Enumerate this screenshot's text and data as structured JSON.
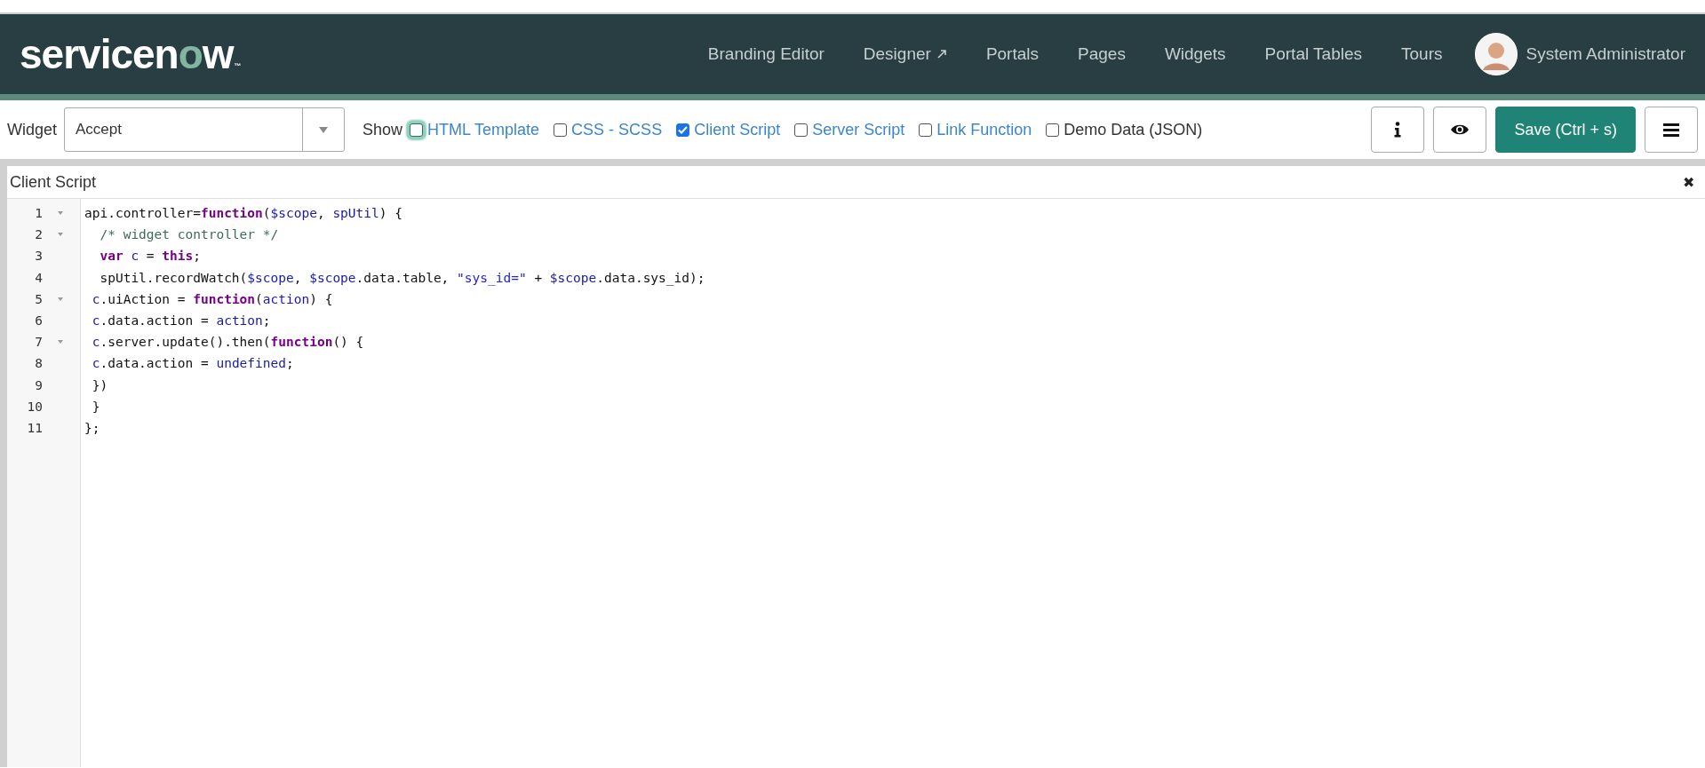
{
  "header": {
    "logo": "servicenow",
    "logo_mark": "™",
    "nav": [
      {
        "label": "Branding Editor",
        "external": false
      },
      {
        "label": "Designer",
        "external": true
      },
      {
        "label": "Portals",
        "external": false
      },
      {
        "label": "Pages",
        "external": false
      },
      {
        "label": "Widgets",
        "external": false
      },
      {
        "label": "Portal Tables",
        "external": false
      },
      {
        "label": "Tours",
        "external": false
      }
    ],
    "user": {
      "name": "System Administrator"
    }
  },
  "toolbar": {
    "widget_label": "Widget",
    "widget_value": "Accept",
    "show_label": "Show",
    "toggles": [
      {
        "label": "HTML Template",
        "checked": false,
        "focused": true,
        "kind": "link"
      },
      {
        "label": "CSS - SCSS",
        "checked": false,
        "focused": false,
        "kind": "link"
      },
      {
        "label": "Client Script",
        "checked": true,
        "focused": false,
        "kind": "link"
      },
      {
        "label": "Server Script",
        "checked": false,
        "focused": false,
        "kind": "link"
      },
      {
        "label": "Link Function",
        "checked": false,
        "focused": false,
        "kind": "link"
      },
      {
        "label": "Demo Data (JSON)",
        "checked": false,
        "focused": false,
        "kind": "plain"
      }
    ],
    "save_label": "Save (Ctrl + s)"
  },
  "panel": {
    "title": "Client Script",
    "close": "✖",
    "lines": [
      {
        "number": "1",
        "fold": true,
        "tokens": [
          {
            "kind": "plain",
            "text": "api.controller="
          },
          {
            "kind": "keyword",
            "text": "function"
          },
          {
            "kind": "plain",
            "text": "("
          },
          {
            "kind": "variable",
            "text": "$scope"
          },
          {
            "kind": "plain",
            "text": ", "
          },
          {
            "kind": "variable",
            "text": "spUtil"
          },
          {
            "kind": "plain",
            "text": ") {"
          }
        ]
      },
      {
        "number": "2",
        "fold": true,
        "tokens": [
          {
            "kind": "comment",
            "text": "  /* widget controller */"
          }
        ]
      },
      {
        "number": "3",
        "fold": false,
        "tokens": [
          {
            "kind": "keyword",
            "text": "  var"
          },
          {
            "kind": "variable",
            "text": " c"
          },
          {
            "kind": "plain",
            "text": " = "
          },
          {
            "kind": "keyword",
            "text": "this"
          },
          {
            "kind": "plain",
            "text": ";"
          }
        ]
      },
      {
        "number": "4",
        "fold": false,
        "tokens": [
          {
            "kind": "plain",
            "text": "  spUtil.recordWatch("
          },
          {
            "kind": "variable",
            "text": "$scope"
          },
          {
            "kind": "plain",
            "text": ", "
          },
          {
            "kind": "variable",
            "text": "$scope"
          },
          {
            "kind": "plain",
            "text": ".data.table, "
          },
          {
            "kind": "string",
            "text": "\"sys_id=\""
          },
          {
            "kind": "plain",
            "text": " + "
          },
          {
            "kind": "variable",
            "text": "$scope"
          },
          {
            "kind": "plain",
            "text": ".data.sys_id);"
          }
        ]
      },
      {
        "number": "5",
        "fold": true,
        "tokens": [
          {
            "kind": "variable",
            "text": " c"
          },
          {
            "kind": "plain",
            "text": ".uiAction = "
          },
          {
            "kind": "keyword",
            "text": "function"
          },
          {
            "kind": "plain",
            "text": "("
          },
          {
            "kind": "variable",
            "text": "action"
          },
          {
            "kind": "plain",
            "text": ") {"
          }
        ]
      },
      {
        "number": "6",
        "fold": false,
        "tokens": [
          {
            "kind": "variable",
            "text": " c"
          },
          {
            "kind": "plain",
            "text": ".data.action = "
          },
          {
            "kind": "variable",
            "text": "action"
          },
          {
            "kind": "plain",
            "text": ";"
          }
        ]
      },
      {
        "number": "7",
        "fold": true,
        "tokens": [
          {
            "kind": "variable",
            "text": " c"
          },
          {
            "kind": "plain",
            "text": ".server.update().then("
          },
          {
            "kind": "keyword",
            "text": "function"
          },
          {
            "kind": "plain",
            "text": "() {"
          }
        ]
      },
      {
        "number": "8",
        "fold": false,
        "tokens": [
          {
            "kind": "variable",
            "text": " c"
          },
          {
            "kind": "plain",
            "text": ".data.action = "
          },
          {
            "kind": "variable",
            "text": "undefined"
          },
          {
            "kind": "plain",
            "text": ";"
          }
        ]
      },
      {
        "number": "9",
        "fold": false,
        "tokens": [
          {
            "kind": "plain",
            "text": " })"
          }
        ]
      },
      {
        "number": "10",
        "fold": false,
        "tokens": [
          {
            "kind": "plain",
            "text": " }"
          }
        ]
      },
      {
        "number": "11",
        "fold": false,
        "tokens": [
          {
            "kind": "plain",
            "text": "};"
          }
        ]
      }
    ]
  }
}
